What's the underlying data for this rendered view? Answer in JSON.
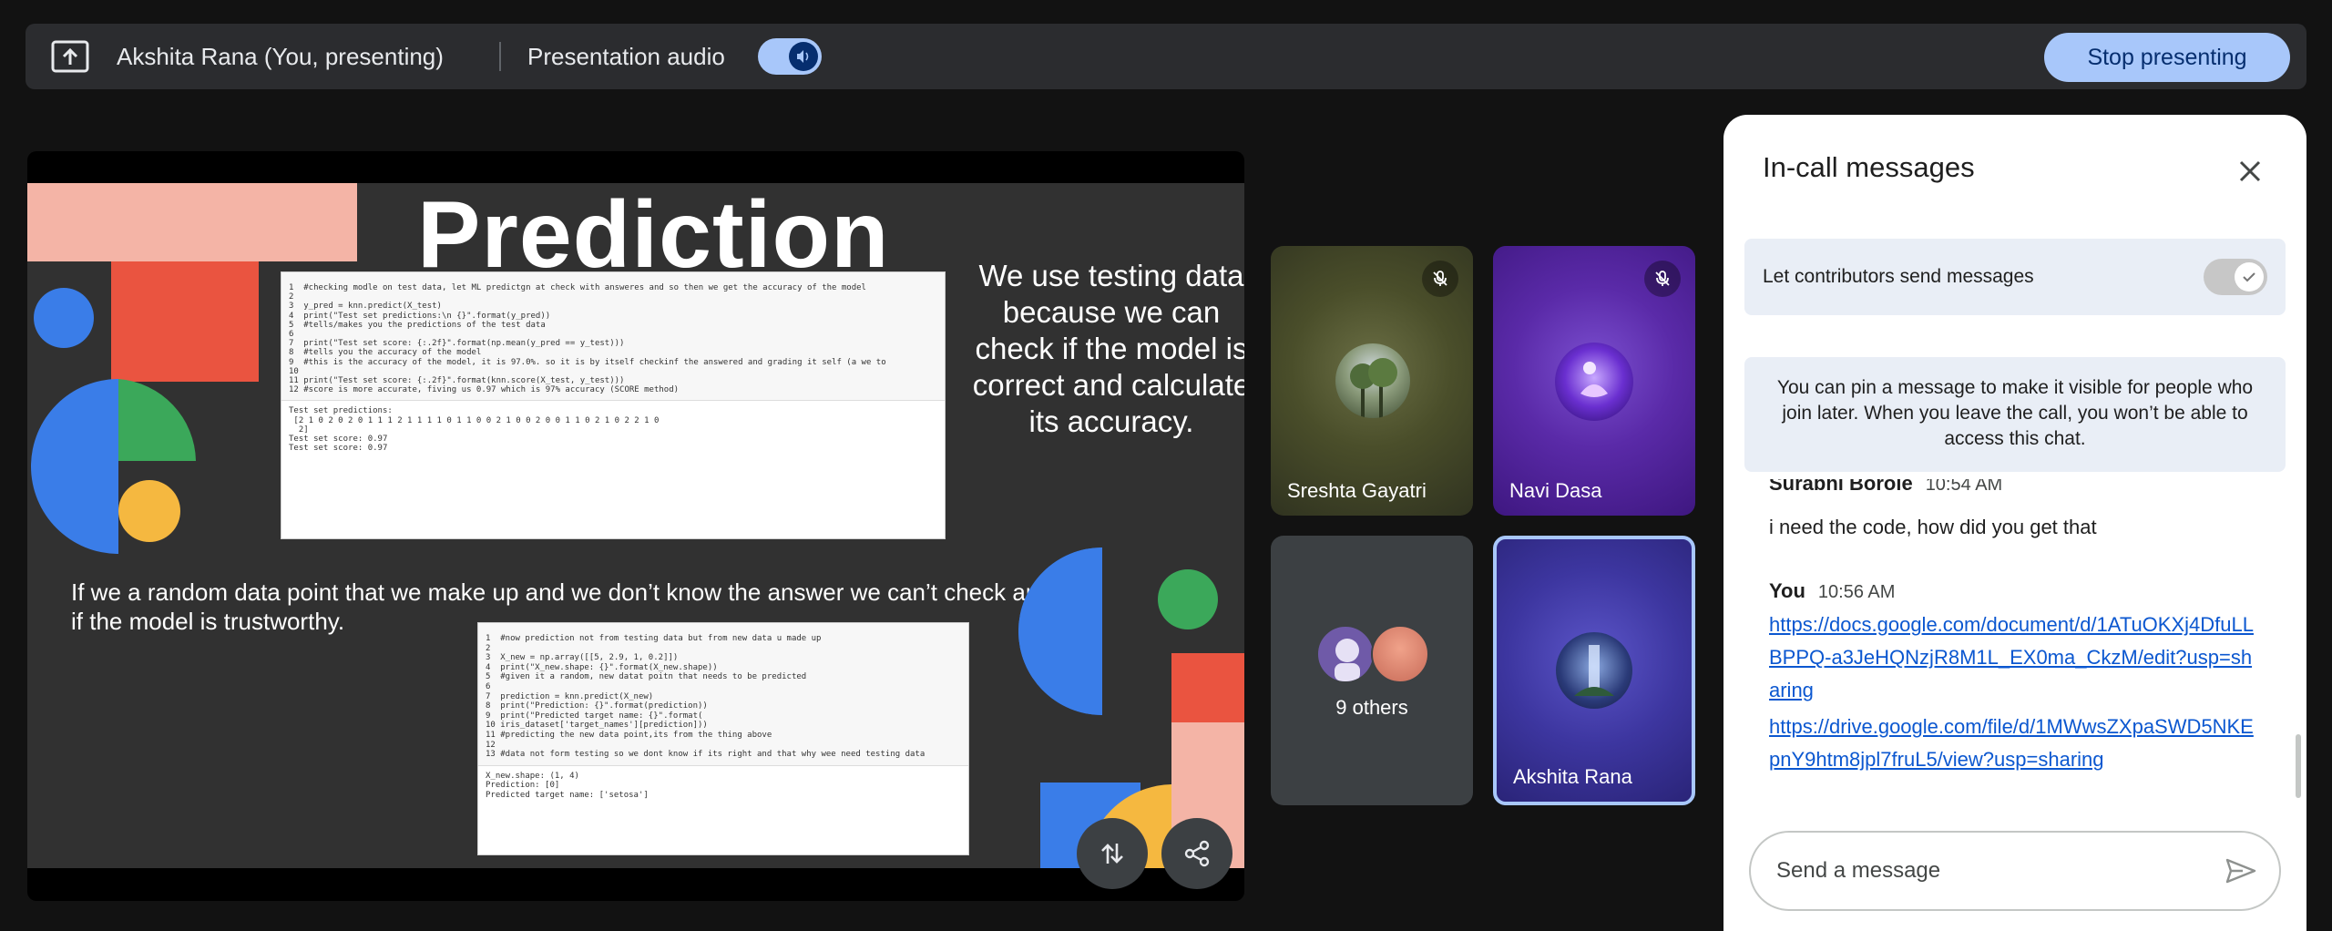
{
  "topbar": {
    "presenter_label": "Akshita Rana (You, presenting)",
    "audio_label": "Presentation audio",
    "audio_on": true,
    "stop_label": "Stop presenting"
  },
  "slide": {
    "title": "Prediction",
    "side_text": "We use testing data because we can check if the model is correct and calculate its accuracy.",
    "bottom_text": "If we a random data point that we make up and we don’t know the answer we can’t check and see if the model is trustworthy.",
    "code1": [
      "1  #checking modle on test data, let ML predictgn at check with answeres and so then we get the accuracy of the model",
      "2",
      "3  y_pred = knn.predict(X_test)",
      "4  print(\"Test set predictions:\\n {}\".format(y_pred))",
      "5  #tells/makes you the predictions of the test data",
      "6",
      "7  print(\"Test set score: {:.2f}\".format(np.mean(y_pred == y_test)))",
      "8  #tells you the accuracy of the model",
      "9  #this is the accuracy of the model, it is 97.0%. so it is by itself checkinf the answered and grading it self (a we to",
      "10",
      "11 print(\"Test set score: {:.2f}\".format(knn.score(X_test, y_test)))",
      "12 #score is more accurate, fiving us 0.97 which is 97% accuracy (SCORE method)"
    ],
    "code1_output": [
      "Test set predictions:",
      " [2 1 0 2 0 2 0 1 1 1 2 1 1 1 1 0 1 1 0 0 2 1 0 0 2 0 0 1 1 0 2 1 0 2 2 1 0",
      "  2]",
      "Test set score: 0.97",
      "Test set score: 0.97"
    ],
    "code2": [
      "1  #now prediction not from testing data but from new data u made up",
      "2",
      "3  X_new = np.array([[5, 2.9, 1, 0.2]])",
      "4  print(\"X_new.shape: {}\".format(X_new.shape))",
      "5  #given it a random, new datat poitn that needs to be predicted",
      "6",
      "7  prediction = knn.predict(X_new)",
      "8  print(\"Prediction: {}\".format(prediction))",
      "9  print(\"Predicted target name: {}\".format(",
      "10 iris_dataset['target_names'][prediction]))",
      "11 #predicting the new data point,its from the thing above",
      "12",
      "13 #data not form testing so we dont know if its right and that why wee need testing data"
    ],
    "code2_output": [
      "X_new.shape: (1, 4)",
      "Prediction: [0]",
      "Predicted target name: ['setosa']"
    ]
  },
  "participants": [
    {
      "name": "Sreshta Gayatri",
      "muted": true
    },
    {
      "name": "Navi Dasa",
      "muted": true
    },
    {
      "name": "9 others",
      "muted": false
    },
    {
      "name": "Akshita Rana",
      "muted": false
    }
  ],
  "chat": {
    "title": "In-call messages",
    "permission_label": "Let contributors send messages",
    "permission_on": true,
    "pin_info": "You can pin a message to make it visible for people who join later. When you leave the call, you won’t be able to access this chat.",
    "messages": [
      {
        "sender": "Surabhi Borole",
        "time": "10:54 AM",
        "text": "i need the code, how did you get that"
      },
      {
        "sender": "You",
        "time": "10:56 AM",
        "link1": "https://docs.google.com/document/d/1ATuOKXj4DfuLLBPPQ-a3JeHQNzjR8M1L_EX0ma_CkzM/edit?usp=sharing",
        "link2": "https://drive.google.com/file/d/1MWwsZXpaSWD5NKEpnY9htm8jpl7fruL5/view?usp=sharing"
      }
    ],
    "composer_placeholder": "Send a message"
  },
  "colors": {
    "accent": "#a8c7fa",
    "link": "#0b57d0",
    "chat_bg": "#ffffff",
    "info_bg": "#e9eef6"
  }
}
